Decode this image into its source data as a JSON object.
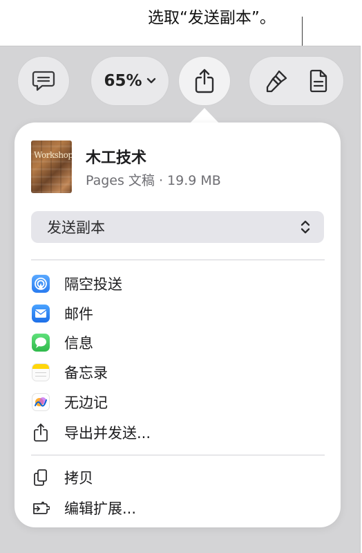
{
  "callout": {
    "text": "选取“发送副本”。"
  },
  "toolbar": {
    "zoom": "65%",
    "icons": [
      "comment-icon",
      "chevron-down-icon",
      "share-icon",
      "format-brush-icon",
      "document-icon"
    ]
  },
  "document": {
    "title": "木工技术",
    "meta": "Pages 文稿 · 19.9 MB",
    "thumbnail_text": "Workshop"
  },
  "send_mode": {
    "selected": "发送副本"
  },
  "share_targets": [
    {
      "label": "隔空投送",
      "icon": "airdrop-icon"
    },
    {
      "label": "邮件",
      "icon": "mail-icon"
    },
    {
      "label": "信息",
      "icon": "messages-icon"
    },
    {
      "label": "备忘录",
      "icon": "notes-icon"
    },
    {
      "label": "无边记",
      "icon": "freeform-icon"
    },
    {
      "label": "导出并发送...",
      "icon": "export-icon"
    }
  ],
  "actions": [
    {
      "label": "拷贝",
      "icon": "copy-icon"
    },
    {
      "label": "编辑扩展...",
      "icon": "extensions-icon"
    }
  ],
  "colors": {
    "background": "#d4d4d6",
    "popover": "#ffffff",
    "select_bg": "#e5e5ea",
    "airdrop": "#3b8ef5",
    "mail": "#2f7ff3",
    "messages": "#34c759",
    "notes": "#ffd60a"
  }
}
